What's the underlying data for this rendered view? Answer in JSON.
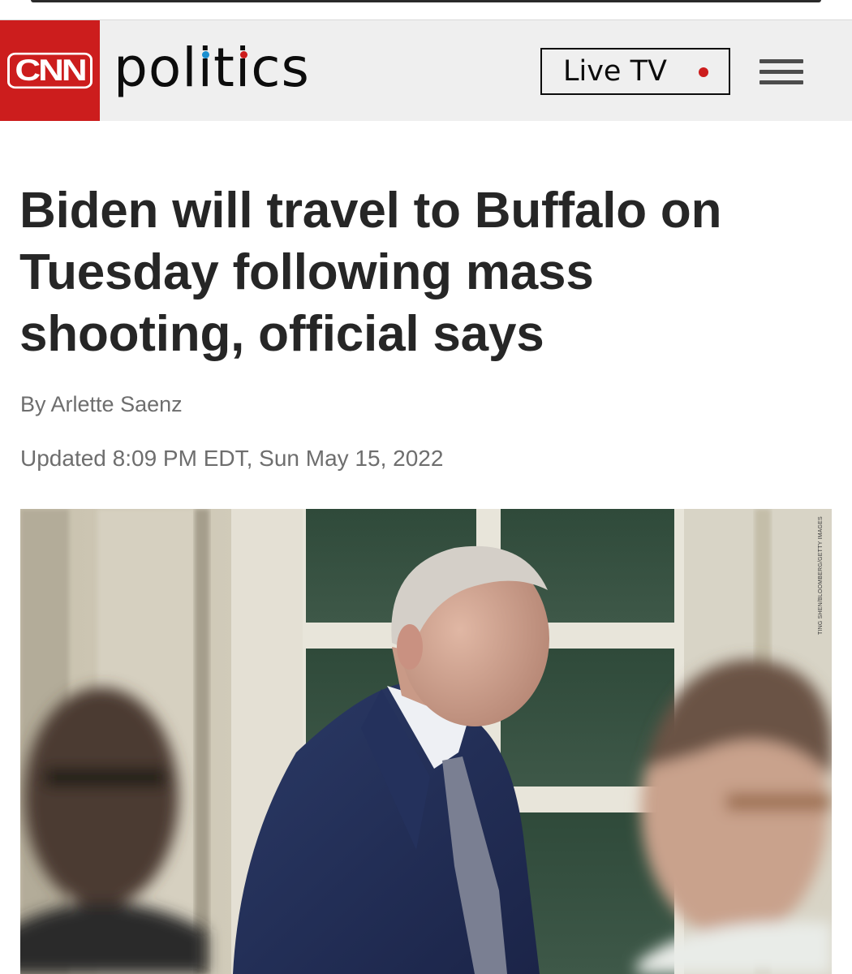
{
  "header": {
    "logo_text": "CNN",
    "section": {
      "before": "pol",
      "i1": "i",
      "mid": "t",
      "i2": "i",
      "after": "cs",
      "dot_colors": [
        "#1a8fd0",
        "#cc1d1d"
      ]
    },
    "live_tv_label": "Live TV",
    "live_dot_color": "#cc1d1d",
    "menu_icon": "hamburger-menu-icon",
    "brand_color": "#cc1d1d"
  },
  "article": {
    "headline": "Biden will travel to Buffalo on Tuesday following mass shooting, official says",
    "byline_prefix": "By ",
    "author": "Arlette Saenz",
    "updated": "Updated 8:09 PM EDT, Sun May 15, 2022",
    "photo_credit": "TING SHEN/BLOOMBERG/GETTY IMAGES"
  }
}
